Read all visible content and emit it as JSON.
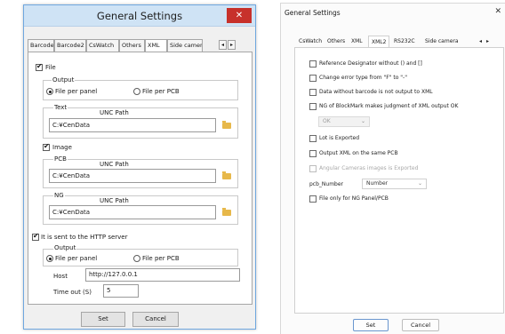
{
  "left_dialog": {
    "title": "General Settings",
    "close_glyph": "✕",
    "tabs": [
      "Barcode",
      "Barcode2",
      "CsWatch",
      "Others",
      "XML",
      "Side camera"
    ],
    "active_tab": "XML",
    "tab_scroll": {
      "left": "◂",
      "right": "▸"
    },
    "file_checkbox": {
      "label": "File",
      "checked": true
    },
    "file_output": {
      "title": "Output",
      "option1": "File per panel",
      "option2": "File per PCB",
      "selected": "File per panel"
    },
    "text_group": {
      "title": "Text",
      "unc_label": "UNC Path",
      "path": "C:¥CenData"
    },
    "image_checkbox": {
      "label": "Image",
      "checked": true
    },
    "pcb_group": {
      "title": "PCB",
      "unc_label": "UNC Path",
      "path": "C:¥CenData"
    },
    "ng_group": {
      "title": "NG",
      "unc_label": "UNC Path",
      "path": "C:¥CenData"
    },
    "http_checkbox": {
      "label": "It is sent to the HTTP server",
      "checked": true
    },
    "http_output": {
      "title": "Output",
      "option1": "File per panel",
      "option2": "File per PCB",
      "selected": "File per panel"
    },
    "host": {
      "label": "Host",
      "value": "http://127.0.0.1"
    },
    "timeout": {
      "label": "Time out (S)",
      "value": "5"
    },
    "buttons": {
      "set": "Set",
      "cancel": "Cancel"
    }
  },
  "right_dialog": {
    "title": "General Settings",
    "close_glyph": "✕",
    "tabs": [
      "CsWatch",
      "Others",
      "XML",
      "XML2",
      "RS232C",
      "Side camera"
    ],
    "active_tab": "XML2",
    "tab_scroll": {
      "left": "◂",
      "right": "▸"
    },
    "options": {
      "ref_designator": {
        "label": "Reference Designator without () and []",
        "checked": false
      },
      "change_error": {
        "label": "Change error type from \"F\" to \"-\"",
        "checked": false
      },
      "no_barcode": {
        "label": "Data without barcode is not output to XML",
        "checked": false
      },
      "ng_blockmark": {
        "label": "NG of BlockMark makes judgment of XML output OK",
        "checked": false
      },
      "ok_combo": {
        "value": "OK",
        "enabled": false
      },
      "lot_exported": {
        "label": "Lot is Exported",
        "checked": false
      },
      "output_same_pcb": {
        "label": "Output XML on the same PCB",
        "checked": false
      },
      "angular_cameras": {
        "label": "Angular Cameras images is Exported",
        "checked": false,
        "enabled": false
      },
      "pcb_number": {
        "label": "pcb_Number",
        "value": "Number"
      },
      "ng_only": {
        "label": "File only for NG Panel/PCB",
        "checked": false
      }
    },
    "buttons": {
      "set": "Set",
      "cancel": "Cancel"
    }
  }
}
